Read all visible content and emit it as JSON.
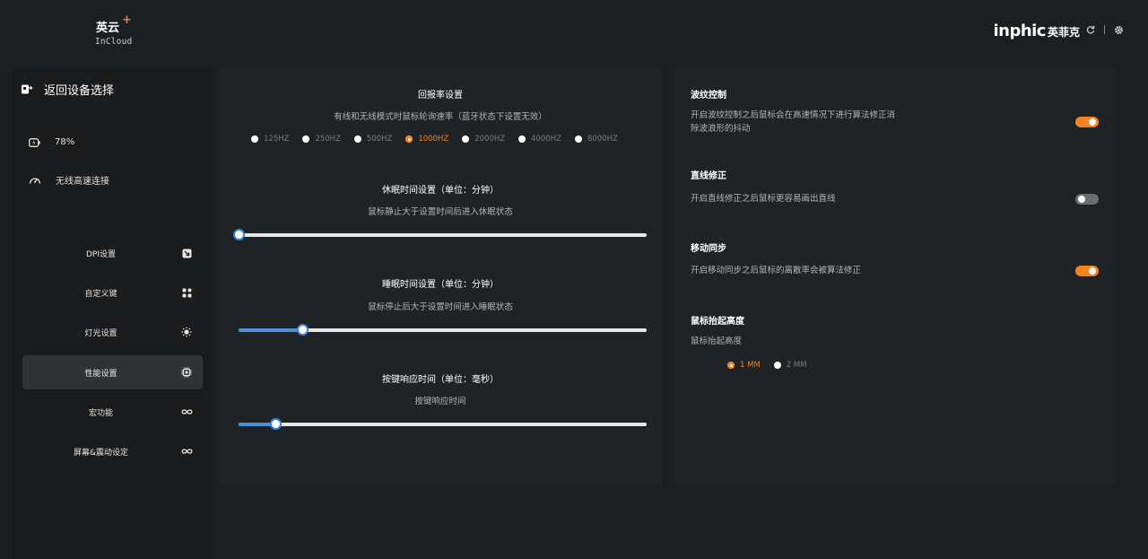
{
  "app": {
    "logo_cn": "英云",
    "logo_plus": "+",
    "logo_en": "InCloud",
    "brand_en": "inphic",
    "brand_cn": "英菲克"
  },
  "sidebar": {
    "back_label": "返回设备选择",
    "battery": "78%",
    "connection": "无线高速连接",
    "items": [
      {
        "label": "DPI设置",
        "icon": "dpi-icon",
        "active": false
      },
      {
        "label": "自定义键",
        "icon": "grid-icon",
        "active": false
      },
      {
        "label": "灯光设置",
        "icon": "sun-icon",
        "active": false
      },
      {
        "label": "性能设置",
        "icon": "chip-icon",
        "active": true
      },
      {
        "label": "宏功能",
        "icon": "infinity-icon",
        "active": false
      },
      {
        "label": "屏幕&震动设定",
        "icon": "infinity-icon",
        "active": false
      }
    ]
  },
  "polling": {
    "title": "回报率设置",
    "desc": "有线和无线模式时鼠标轮询速率（蓝牙状态下设置无效）",
    "options": [
      "125HZ",
      "250HZ",
      "500HZ",
      "1000HZ",
      "2000HZ",
      "4000HZ",
      "8000HZ"
    ],
    "selected": "1000HZ"
  },
  "sleep": {
    "title": "休眠时间设置（单位：分钟）",
    "desc": "鼠标静止大于设置时间后进入休眠状态",
    "level": 0.0
  },
  "deep_sleep": {
    "title": "睡眠时间设置（单位：分钟）",
    "desc": "鼠标停止后大于设置时间进入睡眠状态",
    "level": 0.155
  },
  "key_response": {
    "title": "按键响应时间（单位：毫秒）",
    "desc": "按键响应时间",
    "level": 0.09
  },
  "right": {
    "ripple": {
      "title": "波纹控制",
      "desc": "开启波纹控制之后鼠标会在高速情况下进行算法修正消除波浪形的抖动",
      "on": true
    },
    "straight": {
      "title": "直线修正",
      "desc": "开启直线修正之后鼠标更容易画出直线",
      "on": false
    },
    "motion_sync": {
      "title": "移动同步",
      "desc": "开启移动同步之后鼠标的离散率会被算法修正",
      "on": true
    },
    "lod": {
      "title": "鼠标抬起高度",
      "desc": "鼠标抬起高度",
      "options": [
        "1 MM",
        "2 MM"
      ],
      "selected": "1 MM"
    }
  },
  "colors": {
    "accent": "#f5821f",
    "slider": "#4a90d9",
    "panel": "#202325",
    "background": "#1c1f21"
  }
}
